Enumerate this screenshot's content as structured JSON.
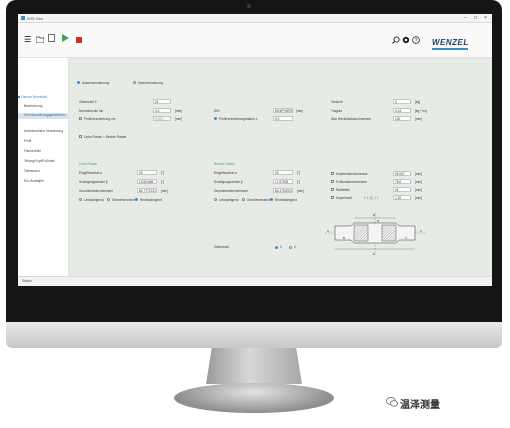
{
  "window": {
    "title": "WIS Gen",
    "controls": [
      "–",
      "□",
      "×"
    ]
  },
  "toolbar": {
    "brand": "WENZEL",
    "icons": [
      "menu-icon",
      "folder-icon",
      "new-document-icon",
      "play-icon",
      "stop-icon",
      "search-icon",
      "gear-icon",
      "help-icon"
    ]
  },
  "sidebar": {
    "items": [
      {
        "label": "Flansch Bereitstell",
        "active": true
      },
      {
        "label": "Bezeichnung"
      },
      {
        "label": "Grundsonderungsgabebenen",
        "active_sub": true
      },
      {
        "label": "Unterbrochene Verzahnung"
      },
      {
        "label": "Profil"
      },
      {
        "label": "Flankenlinie"
      },
      {
        "label": "Teilung/Kopf/Fußkreis"
      },
      {
        "label": "Toleranzen"
      },
      {
        "label": "Ein-/Ausfalpfe"
      }
    ]
  },
  "mode": {
    "options": [
      "Aussenverzahnung",
      "Innenverzahnung"
    ],
    "selected": 0
  },
  "params_left": [
    {
      "label": "Zähnezahl  Z",
      "value": "21",
      "unit": ""
    },
    {
      "label": "Normalmodul  mn",
      "value": "4.0",
      "unit": "[mm]"
    },
    {
      "label": "Profilverschiebung  xm",
      "value": "0.000",
      "unit": "[mm]",
      "disabled": true,
      "checkbox": true
    }
  ],
  "params_mid": [
    {
      "label": "DIN",
      "value": "DIN/PHDP867",
      "unit": "[mm]"
    },
    {
      "label": "Profilverschiebungsfaktor  x",
      "value": "0.0",
      "unit": "",
      "radio": true
    }
  ],
  "params_right": [
    {
      "label": "Gewicht",
      "value": "0",
      "unit": "[kg]"
    },
    {
      "label": "Tragrad",
      "value": "0.04",
      "unit": "[kg * m²]"
    },
    {
      "label": "Max Werkstückdurchmesser",
      "value": "130",
      "unit": "[mm]"
    }
  ],
  "flank_choice": {
    "label": "Linke Flanke = Rechte Flanke"
  },
  "left_flank": {
    "title": "Linke Flanke",
    "fields": [
      {
        "label": "Eingriffswinkel  α",
        "value": "20",
        "unit": "[°]"
      },
      {
        "label": "Schrägungswinkel  β",
        "value": "13.50/468",
        "unit": "[°]"
      },
      {
        "label": "Grundkreisdurchmesser",
        "value": "84.777123144",
        "unit": "[mm]"
      }
    ],
    "direction": [
      "Linkssteigend",
      "Geradeverzahnt",
      "Rechtssteigend"
    ],
    "direction_selected": 2
  },
  "right_flank": {
    "title": "Rechte Flanke",
    "fields": [
      {
        "label": "Eingriffswinkel  α",
        "value": "20",
        "unit": "[°]"
      },
      {
        "label": "Schrägungswinkel  β",
        "value": "17.87933",
        "unit": "[°]"
      },
      {
        "label": "Grundkreisdurchmesser",
        "value": "84.4792000",
        "unit": "[mm]"
      }
    ],
    "direction": [
      "Linkssteigend",
      "Geradeverzahnt",
      "Rechtssteigend"
    ],
    "direction_selected": 2
  },
  "geometry": {
    "fields": [
      {
        "label": "Kopfkreisdurchmesser",
        "value": "92.007",
        "unit": "[mm]"
      },
      {
        "label": "Fußkreisdurchmesser",
        "value": "78.0",
        "unit": "[mm]"
      },
      {
        "label": "Radbreite",
        "value": "41",
        "unit": "[mm]"
      },
      {
        "label": "Kapselmaß",
        "value": "1.20",
        "unit": "[mm]",
        "extra": "1  1  (3)  1  1"
      }
    ],
    "diagram_labels": [
      "D",
      "b",
      "A",
      "B",
      "C",
      "E",
      "S"
    ]
  },
  "count": {
    "label": "Zähnezahl",
    "options": [
      "1",
      "2"
    ],
    "selected": 0
  },
  "statusbar": {
    "text": "Status"
  },
  "watermark": {
    "text": "温泽测量"
  },
  "colors": {
    "accent": "#3c8ec9",
    "section": "#4aa36a",
    "panel": "#e6ebe6",
    "run": "#3aa84a",
    "stop": "#d62b2b"
  }
}
